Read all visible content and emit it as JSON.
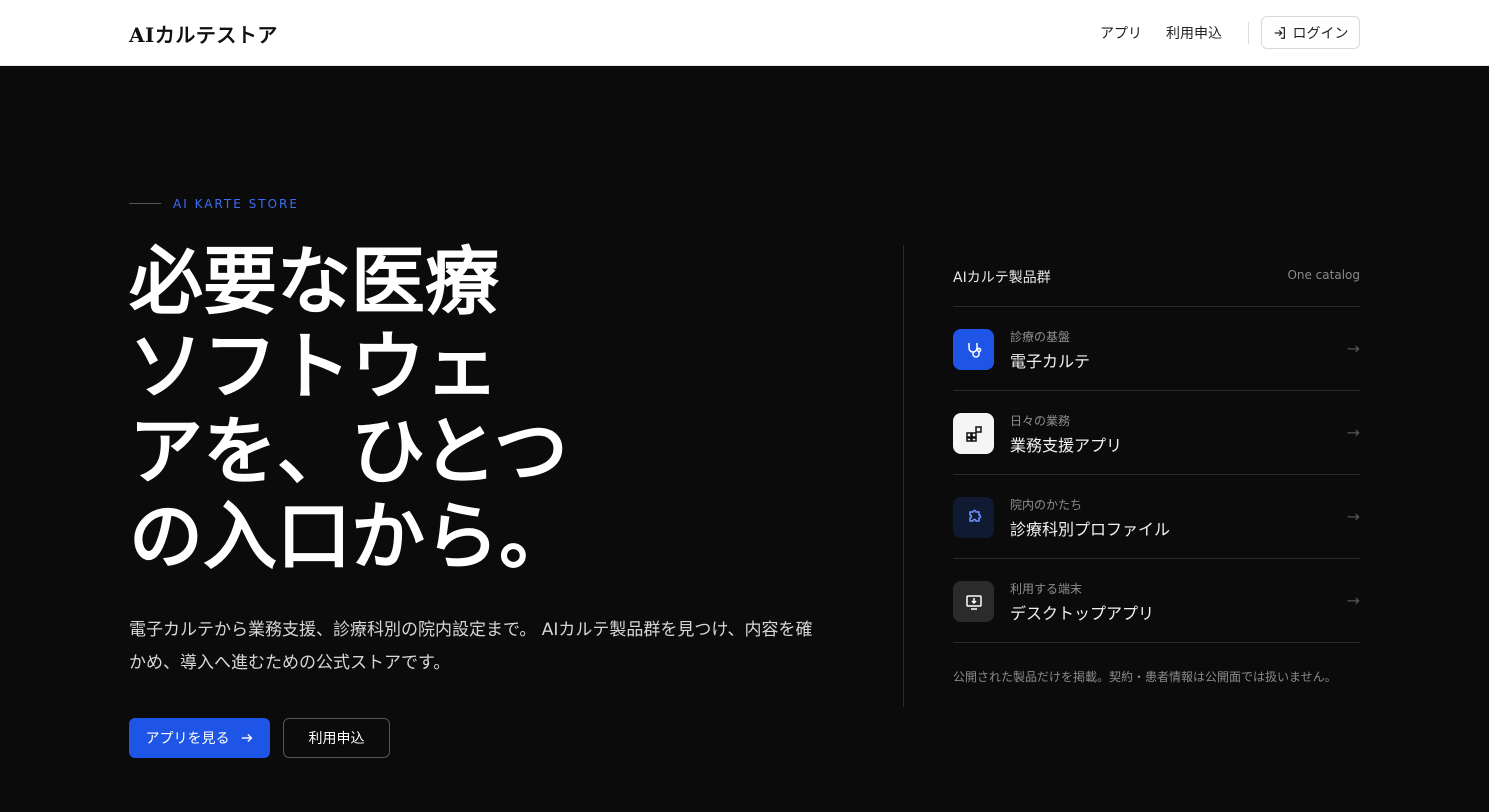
{
  "header": {
    "brand": "AIカルテストア",
    "nav_apps": "アプリ",
    "nav_apply": "利用申込",
    "login_label": "ログイン"
  },
  "hero": {
    "eyebrow": "AI KARTE STORE",
    "headline_lines": [
      "必要な医療",
      "ソフトウェ",
      "アを、ひとつ",
      "の入口から。"
    ],
    "lead": "電子カルテから業務支援、診療科別の院内設定まで。 AIカルテ製品群を見つけ、内容を確かめ、導入へ進むための公式ストアです。",
    "primary_button": "アプリを見る",
    "secondary_button": "利用申込"
  },
  "catalog": {
    "title": "AIカルテ製品群",
    "note": "One catalog",
    "items": [
      {
        "sub": "診療の基盤",
        "name": "電子カルテ",
        "icon": "stethoscope-icon",
        "bg": "#1f55e6",
        "fg": "#ffffff"
      },
      {
        "sub": "日々の業務",
        "name": "業務支援アプリ",
        "icon": "widgets-icon",
        "bg": "#f5f5f5",
        "fg": "#111111"
      },
      {
        "sub": "院内のかたち",
        "name": "診療科別プロファイル",
        "icon": "puzzle-icon",
        "bg": "#101a33",
        "fg": "#6e93ff"
      },
      {
        "sub": "利用する端末",
        "name": "デスクトップアプリ",
        "icon": "monitor-download-icon",
        "bg": "#2b2b2b",
        "fg": "#ffffff"
      }
    ],
    "footnote": "公開された製品だけを掲載。契約・患者情報は公開面では扱いません。"
  }
}
